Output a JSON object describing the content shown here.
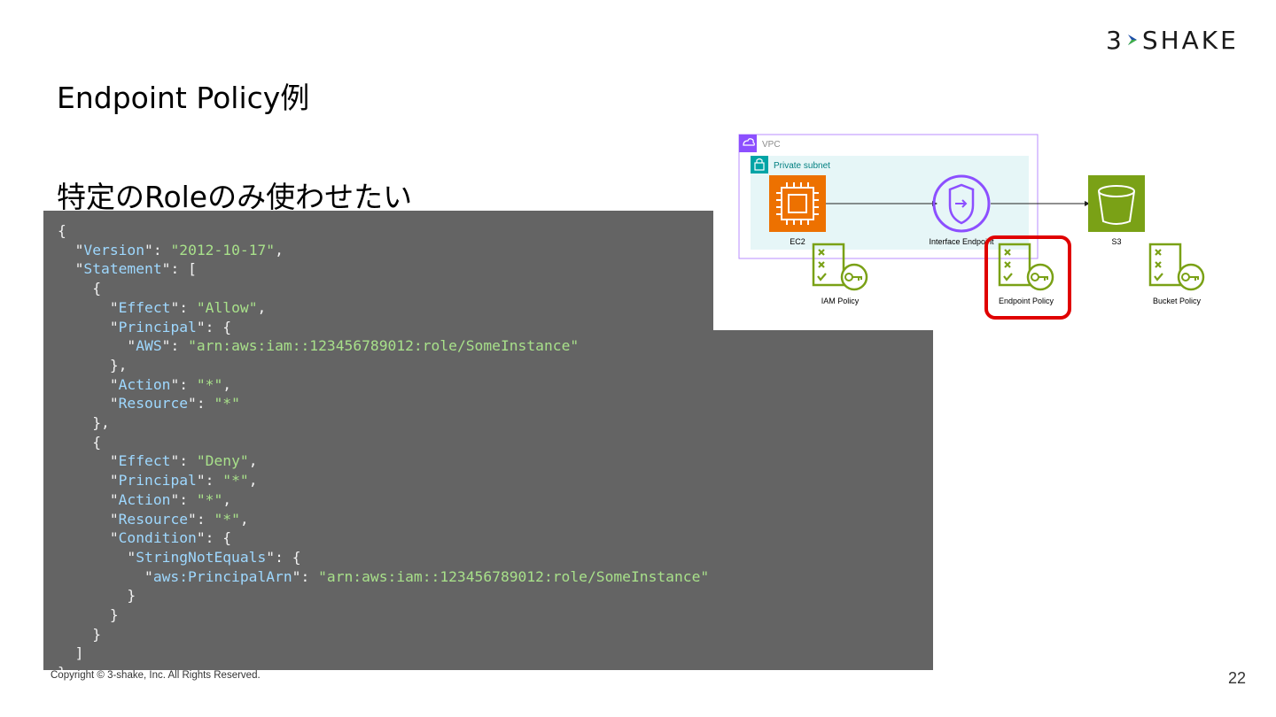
{
  "logo": {
    "text_left": "3",
    "text_right": "SHAKE"
  },
  "title": "Endpoint Policy例",
  "subtitle": "特定のRoleのみ使わせたい",
  "code": {
    "lines": [
      [
        [
          "p",
          "{"
        ]
      ],
      [
        [
          "p",
          "  \""
        ],
        [
          "k",
          "Version"
        ],
        [
          "p",
          "\": "
        ],
        [
          "s",
          "\"2012-10-17\""
        ],
        [
          "p",
          ","
        ]
      ],
      [
        [
          "p",
          "  \""
        ],
        [
          "k",
          "Statement"
        ],
        [
          "p",
          "\": ["
        ]
      ],
      [
        [
          "p",
          "    {"
        ]
      ],
      [
        [
          "p",
          "      \""
        ],
        [
          "k",
          "Effect"
        ],
        [
          "p",
          "\": "
        ],
        [
          "s",
          "\"Allow\""
        ],
        [
          "p",
          ","
        ]
      ],
      [
        [
          "p",
          "      \""
        ],
        [
          "k",
          "Principal"
        ],
        [
          "p",
          "\": {"
        ]
      ],
      [
        [
          "p",
          "        \""
        ],
        [
          "k",
          "AWS"
        ],
        [
          "p",
          "\": "
        ],
        [
          "s",
          "\"arn:aws:iam::123456789012:role/SomeInstance\""
        ]
      ],
      [
        [
          "p",
          "      },"
        ]
      ],
      [
        [
          "p",
          "      \""
        ],
        [
          "k",
          "Action"
        ],
        [
          "p",
          "\": "
        ],
        [
          "s",
          "\"*\""
        ],
        [
          "p",
          ","
        ]
      ],
      [
        [
          "p",
          "      \""
        ],
        [
          "k",
          "Resource"
        ],
        [
          "p",
          "\": "
        ],
        [
          "s",
          "\"*\""
        ]
      ],
      [
        [
          "p",
          "    },"
        ]
      ],
      [
        [
          "p",
          "    {"
        ]
      ],
      [
        [
          "p",
          "      \""
        ],
        [
          "k",
          "Effect"
        ],
        [
          "p",
          "\": "
        ],
        [
          "s",
          "\"Deny\""
        ],
        [
          "p",
          ","
        ]
      ],
      [
        [
          "p",
          "      \""
        ],
        [
          "k",
          "Principal"
        ],
        [
          "p",
          "\": "
        ],
        [
          "s",
          "\"*\""
        ],
        [
          "p",
          ","
        ]
      ],
      [
        [
          "p",
          "      \""
        ],
        [
          "k",
          "Action"
        ],
        [
          "p",
          "\": "
        ],
        [
          "s",
          "\"*\""
        ],
        [
          "p",
          ","
        ]
      ],
      [
        [
          "p",
          "      \""
        ],
        [
          "k",
          "Resource"
        ],
        [
          "p",
          "\": "
        ],
        [
          "s",
          "\"*\""
        ],
        [
          "p",
          ","
        ]
      ],
      [
        [
          "p",
          "      \""
        ],
        [
          "k",
          "Condition"
        ],
        [
          "p",
          "\": {"
        ]
      ],
      [
        [
          "p",
          "        \""
        ],
        [
          "k",
          "StringNotEquals"
        ],
        [
          "p",
          "\": {"
        ]
      ],
      [
        [
          "p",
          "          \""
        ],
        [
          "k",
          "aws:PrincipalArn"
        ],
        [
          "p",
          "\": "
        ],
        [
          "s",
          "\"arn:aws:iam::123456789012:role/SomeInstance\""
        ]
      ],
      [
        [
          "p",
          "        }"
        ]
      ],
      [
        [
          "p",
          "      }"
        ]
      ],
      [
        [
          "p",
          "    }"
        ]
      ],
      [
        [
          "p",
          "  ]"
        ]
      ],
      [
        [
          "p",
          "}"
        ]
      ]
    ]
  },
  "diagram": {
    "vpc_label": "VPC",
    "subnet_label": "Private subnet",
    "ec2_label": "EC2",
    "endpoint_label": "Interface Endpoint",
    "s3_label": "S3",
    "iam_policy_label": "IAM Policy",
    "endpoint_policy_label": "Endpoint Policy",
    "bucket_policy_label": "Bucket Policy",
    "colors": {
      "vpc_border": "#8c4fff",
      "subnet_fill": "#e6f6f7",
      "subnet_text": "#00a4a6",
      "ec2": "#ed7100",
      "endpoint": "#8c4fff",
      "s3": "#7aa116",
      "policy": "#7aa116",
      "highlight": "#e00000"
    }
  },
  "footer": {
    "copyright": "Copyright © 3-shake, Inc. All Rights Reserved.",
    "page": "22"
  }
}
